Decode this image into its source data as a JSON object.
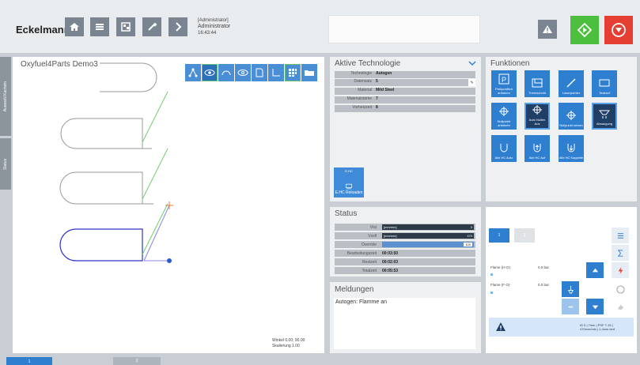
{
  "header": {
    "brand": "Eckelmann",
    "role": "[Administrator]",
    "user": "Administrator",
    "time": "16:43:44"
  },
  "sidebar": {
    "tab1": "Auswahl Kacheln",
    "tab2": "Status"
  },
  "view": {
    "title": "Oxyfuel4Parts Demo3",
    "winkel": "Winkel     0.00; 90.00",
    "skalierung": "Skalierung 1.00"
  },
  "tech": {
    "title": "Aktive Technologie",
    "rows": [
      {
        "k": "Technologie",
        "v": "Autogen"
      },
      {
        "k": "Datensatz",
        "v": "5"
      },
      {
        "k": "Material",
        "v": "Mild Steel"
      },
      {
        "k": "Materialstärke",
        "v": "7"
      },
      {
        "k": "Vorheizzeit",
        "v": "8"
      }
    ],
    "ehc_top": "E.HC",
    "ehc_label": "E.HC Reloaden"
  },
  "funcs": {
    "title": "Funktionen",
    "buttons": [
      {
        "label": "Parkposition anfahren",
        "icon": "parking-icon"
      },
      {
        "label": "Trennschnitt",
        "icon": "cut-icon"
      },
      {
        "label": "Laserpointer",
        "icon": "laser-icon"
      },
      {
        "label": "Testlauf",
        "icon": "test-icon"
      },
      {
        "label": "Nullpunkt anfahren",
        "icon": "zero-drive-icon"
      },
      {
        "label": "Auto Nullen Aus",
        "icon": "auto-zero-icon"
      },
      {
        "label": "Nullpunkt setzen",
        "icon": "zero-set-icon"
      },
      {
        "label": "Absaugung",
        "icon": "exhaust-icon"
      },
      {
        "label": "Alle HC Auto",
        "icon": "hc-auto-icon"
      },
      {
        "label": "Alle HC Auf",
        "icon": "hc-up-icon"
      },
      {
        "label": "Alle HC Kappelle",
        "icon": "hc-cap-icon"
      }
    ]
  },
  "status": {
    "title": "Status",
    "vist_label": "Vist",
    "vist_unit": "[mm/min]",
    "vist_value": "0",
    "vsoll_label": "Vsoll",
    "vsoll_unit": "[mm/min]",
    "vsoll_value": "470",
    "override_label": "Override",
    "override_value": "100",
    "override_percent": 100,
    "bearb_label": "Bearbeitungszeit",
    "bearb_value": "00:03:50",
    "rest_label": "Restzeit",
    "rest_value": "00:02:03",
    "total_label": "Totalzeit",
    "total_value": "00:05:53"
  },
  "meldungen": {
    "title": "Meldungen",
    "text": "Autogen: Flamme an"
  },
  "hc": {
    "tab1": "1",
    "tab2": "1",
    "flame1_label": "Flame (H-O)",
    "flame1_value": "0.0 bar",
    "flame2_label": "Flame (F-O)",
    "flame2_value": "0.0 bar",
    "info": "ID 5 | 7mm | PSF 7-15 | 470mm/min | 1.4mm ​kerf"
  },
  "tabs": {
    "t1": "1",
    "t2": "2"
  },
  "colors": {
    "accent": "#2f7fd1",
    "start": "#4cbf3e",
    "stop": "#e53e33"
  }
}
